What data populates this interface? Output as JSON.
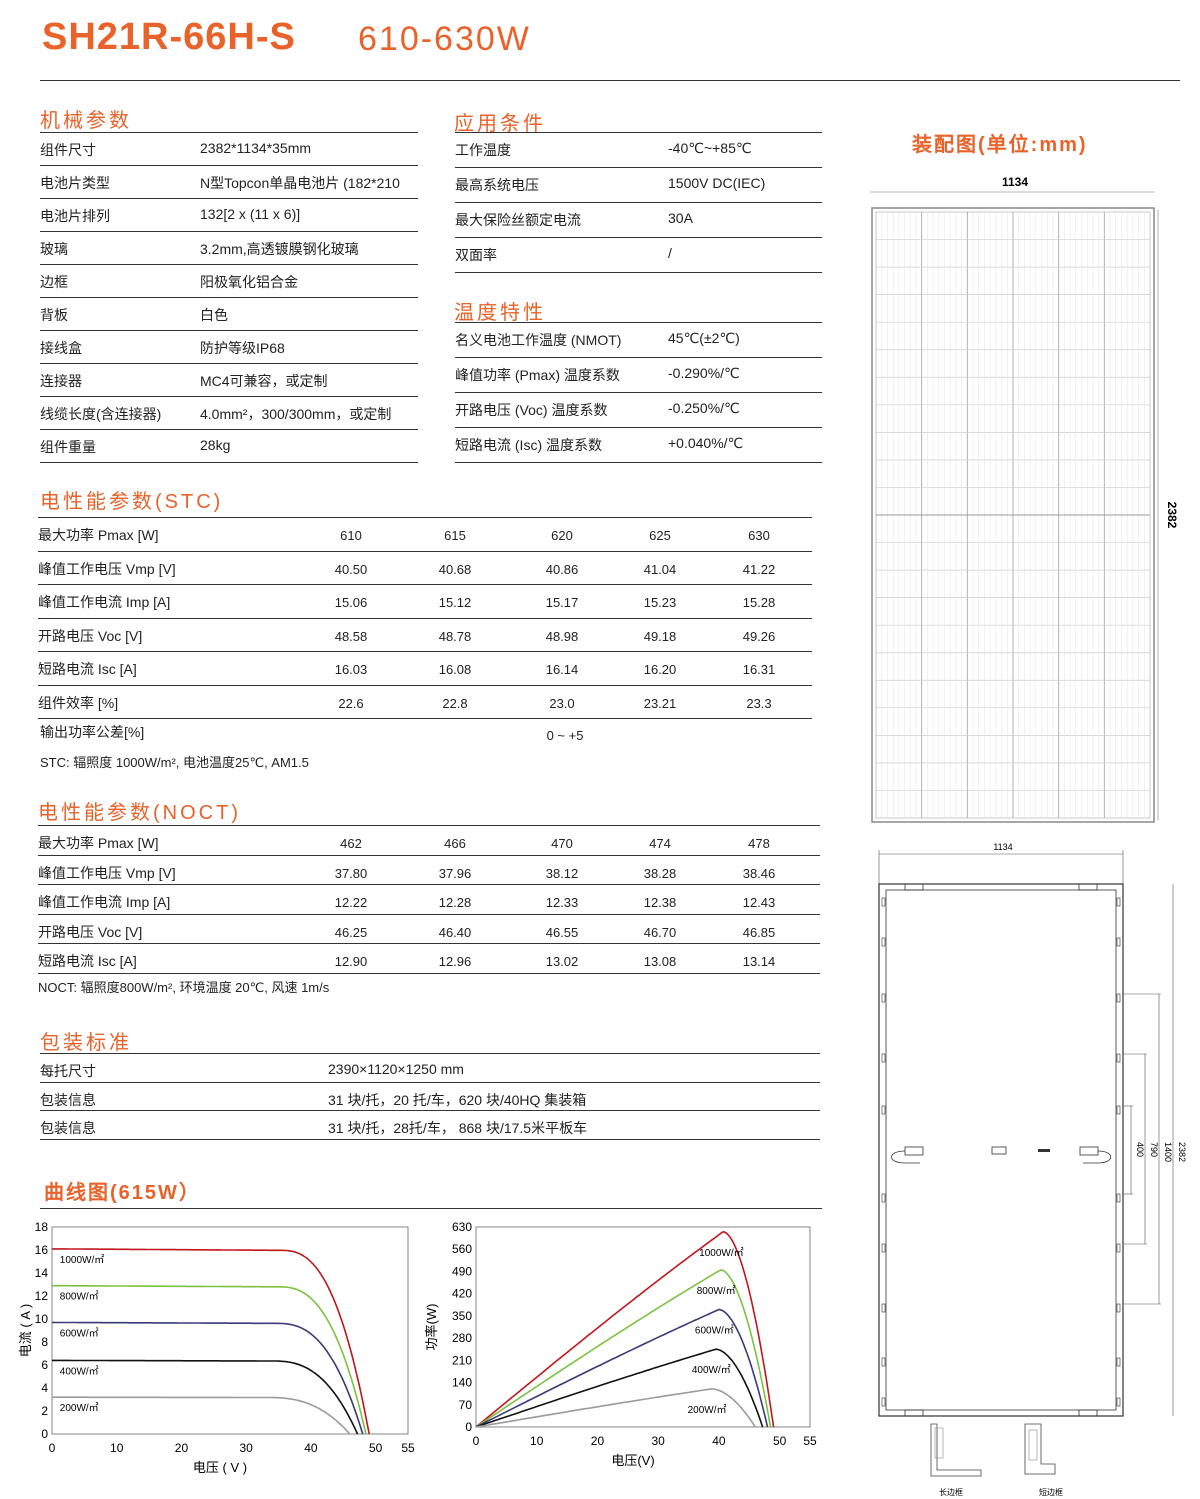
{
  "header": {
    "model": "SH21R-66H-S",
    "power_range": "610-630W"
  },
  "mechanical": {
    "title": "机械参数",
    "rows": [
      {
        "label": "组件尺寸",
        "value": "2382*1134*35mm"
      },
      {
        "label": "电池片类型",
        "value": "N型Topcon单晶电池片 (182*210"
      },
      {
        "label": "电池片排列",
        "value": "132[2 x (11 x 6)]"
      },
      {
        "label": "玻璃",
        "value": "3.2mm,高透镀膜钢化玻璃"
      },
      {
        "label": "边框",
        "value": "阳极氧化铝合金"
      },
      {
        "label": "背板",
        "value": "白色"
      },
      {
        "label": "接线盒",
        "value": "防护等级IP68"
      },
      {
        "label": "连接器",
        "value": "MC4可兼容，或定制"
      },
      {
        "label": "线缆长度(含连接器)",
        "value": "4.0mm²，300/300mm，或定制"
      },
      {
        "label": "组件重量",
        "value": "28kg"
      }
    ]
  },
  "application": {
    "title": "应用条件",
    "rows": [
      {
        "label": "工作温度",
        "value": "-40℃~+85℃"
      },
      {
        "label": "最高系统电压",
        "value": "1500V DC(IEC)"
      },
      {
        "label": "最大保险丝额定电流",
        "value": "30A"
      },
      {
        "label": "双面率",
        "value": "/"
      }
    ]
  },
  "temperature": {
    "title": "温度特性",
    "rows": [
      {
        "label": "名义电池工作温度 (NMOT)",
        "value": "45℃(±2℃)"
      },
      {
        "label": "峰值功率 (Pmax) 温度系数",
        "value": "-0.290%/℃"
      },
      {
        "label": "开路电压 (Voc) 温度系数",
        "value": "-0.250%/℃"
      },
      {
        "label": "短路电流 (Isc) 温度系数",
        "value": "+0.040%/℃"
      }
    ]
  },
  "stc": {
    "title": "电性能参数(STC)",
    "rows": [
      {
        "label": "最大功率 Pmax [W]",
        "values": [
          "610",
          "615",
          "620",
          "625",
          "630"
        ]
      },
      {
        "label": "峰值工作电压 Vmp [V]",
        "values": [
          "40.50",
          "40.68",
          "40.86",
          "41.04",
          "41.22"
        ]
      },
      {
        "label": "峰值工作电流 Imp [A]",
        "values": [
          "15.06",
          "15.12",
          "15.17",
          "15.23",
          "15.28"
        ]
      },
      {
        "label": "开路电压 Voc [V]",
        "values": [
          "48.58",
          "48.78",
          "48.98",
          "49.18",
          "49.26"
        ]
      },
      {
        "label": "短路电流 Isc [A]",
        "values": [
          "16.03",
          "16.08",
          "16.14",
          "16.20",
          "16.31"
        ]
      },
      {
        "label": "组件效率 [%]",
        "values": [
          "22.6",
          "22.8",
          "23.0",
          "23.21",
          "23.3"
        ]
      }
    ],
    "tolerance_label": "输出功率公差[%]",
    "tolerance_value": "0 ~ +5",
    "note": "STC: 辐照度 1000W/m², 电池温度25℃, AM1.5"
  },
  "noct": {
    "title": "电性能参数(NOCT)",
    "rows": [
      {
        "label": "最大功率 Pmax [W]",
        "values": [
          "462",
          "466",
          "470",
          "474",
          "478"
        ]
      },
      {
        "label": "峰值工作电压 Vmp [V]",
        "values": [
          "37.80",
          "37.96",
          "38.12",
          "38.28",
          "38.46"
        ]
      },
      {
        "label": "峰值工作电流 Imp [A]",
        "values": [
          "12.22",
          "12.28",
          "12.33",
          "12.38",
          "12.43"
        ]
      },
      {
        "label": "开路电压 Voc [V]",
        "values": [
          "46.25",
          "46.40",
          "46.55",
          "46.70",
          "46.85"
        ]
      },
      {
        "label": "短路电流 Isc [A]",
        "values": [
          "12.90",
          "12.96",
          "13.02",
          "13.08",
          "13.14"
        ]
      }
    ],
    "note": "NOCT: 辐照度800W/m², 环境温度 20℃, 风速 1m/s"
  },
  "packaging": {
    "title": "包装标准",
    "rows": [
      {
        "label": "每托尺寸",
        "value": "2390×1120×1250 mm"
      },
      {
        "label": "包装信息",
        "value": "31 块/托，20 托/车，620 块/40HQ 集装箱"
      },
      {
        "label": "包装信息",
        "value": "31 块/托，28托/车， 868 块/17.5米平板车"
      }
    ]
  },
  "curves_title": "曲线图(615W）",
  "drawing": {
    "title": "装配图(单位:mm)",
    "front_width": "1134",
    "front_height": "2382",
    "back_width": "1134",
    "back_dims": [
      "2382",
      "1400",
      "790",
      "400"
    ],
    "profile_long": "长边框",
    "profile_short": "短边框"
  },
  "chart_data": [
    {
      "type": "line",
      "title": "",
      "xlabel": "电压 ( V )",
      "ylabel": "电流 ( A )",
      "xlim": [
        0,
        55
      ],
      "ylim": [
        0,
        18
      ],
      "x_ticks": [
        "0",
        "10",
        "20",
        "30",
        "40",
        "50",
        "55"
      ],
      "y_ticks": [
        "0",
        "2",
        "4",
        "6",
        "8",
        "10",
        "12",
        "14",
        "16",
        "18"
      ],
      "series": [
        {
          "name": "1000W/㎡",
          "color": "#c0161d",
          "isc": 16.1,
          "voc": 49.0
        },
        {
          "name": "800W/㎡",
          "color": "#7dc142",
          "isc": 12.9,
          "voc": 48.5
        },
        {
          "name": "600W/㎡",
          "color": "#3a3a7a",
          "isc": 9.7,
          "voc": 48.0
        },
        {
          "name": "400W/㎡",
          "color": "#111111",
          "isc": 6.4,
          "voc": 47.2
        },
        {
          "name": "200W/㎡",
          "color": "#9b9b9b",
          "isc": 3.2,
          "voc": 46.0
        }
      ]
    },
    {
      "type": "line",
      "title": "",
      "xlabel": "电压(V)",
      "ylabel": "功率(W)",
      "xlim": [
        0,
        55
      ],
      "ylim": [
        0,
        630
      ],
      "x_ticks": [
        "0",
        "10",
        "20",
        "30",
        "40",
        "50",
        "55"
      ],
      "y_ticks": [
        "0",
        "70",
        "140",
        "210",
        "280",
        "350",
        "420",
        "490",
        "560",
        "630"
      ],
      "series": [
        {
          "name": "1000W/㎡",
          "color": "#c0161d",
          "pmax": 615,
          "vmp": 40.7,
          "voc": 49.0
        },
        {
          "name": "800W/㎡",
          "color": "#7dc142",
          "pmax": 495,
          "vmp": 40.3,
          "voc": 48.5
        },
        {
          "name": "600W/㎡",
          "color": "#3a3a7a",
          "pmax": 370,
          "vmp": 40.0,
          "voc": 48.0
        },
        {
          "name": "400W/㎡",
          "color": "#111111",
          "pmax": 245,
          "vmp": 39.5,
          "voc": 47.2
        },
        {
          "name": "200W/㎡",
          "color": "#9b9b9b",
          "pmax": 120,
          "vmp": 38.8,
          "voc": 46.0
        }
      ]
    }
  ]
}
